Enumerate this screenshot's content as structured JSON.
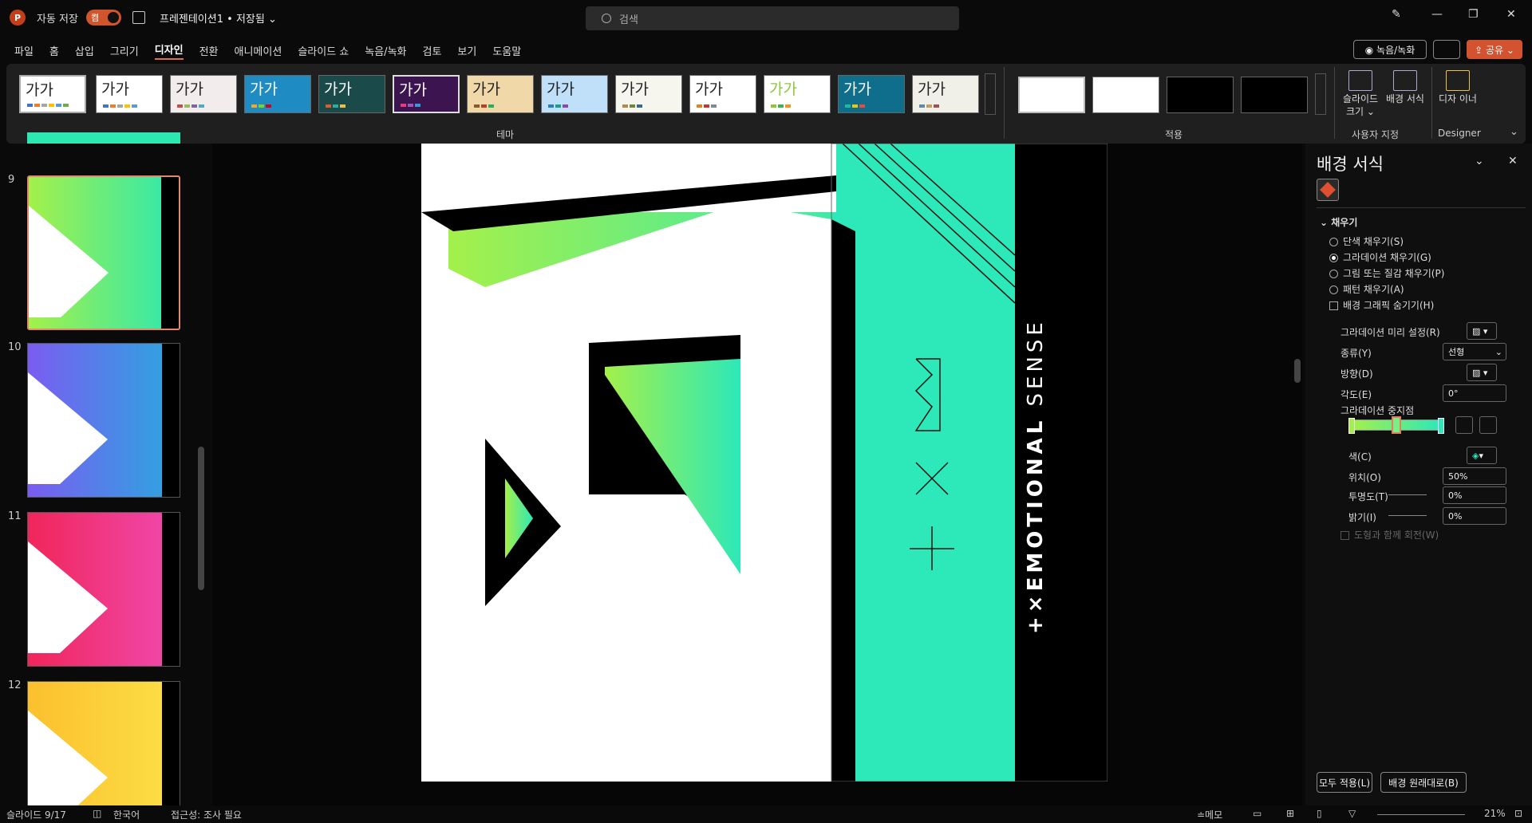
{
  "titlebar": {
    "app_icon": "P",
    "autosave_label": "자동 저장",
    "toggle_state": "켬",
    "doc_title": "프레젠테이션1 • 저장됨 ⌄",
    "search_placeholder": "검색"
  },
  "menu": {
    "items": [
      "파일",
      "홈",
      "삽입",
      "그리기",
      "디자인",
      "전환",
      "애니메이션",
      "슬라이드 쇼",
      "녹음/녹화",
      "검토",
      "보기",
      "도움말"
    ],
    "active": "디자인",
    "record_label": "◉ 녹음/녹화",
    "share_label": "⇪ 공유 ⌄"
  },
  "ribbon": {
    "theme_sample": "가가",
    "theme_group_label": "테마",
    "variant_group_label": "적용",
    "slide_size_label": "슬라이드 크기 ⌄",
    "bg_format_label": "배경 서식",
    "customize_group_label": "사용자 지정",
    "designer_label": "디자 이너",
    "designer_group_label": "Designer"
  },
  "slides_panel": {
    "numbers": [
      "9",
      "10",
      "11",
      "12"
    ],
    "thumb_text": "+×EMOTIONAL SENSE",
    "thumb_colors": [
      "#2de8b0",
      "#5a5ef0",
      "#f0338a",
      "#fbd520"
    ]
  },
  "slide": {
    "brand_bold": "+×EMOTIONAL",
    "brand_light": "SENSE"
  },
  "format_panel": {
    "title": "배경 서식",
    "section": "채우기",
    "options": [
      "단색 채우기(S)",
      "그라데이션 채우기(G)",
      "그림 또는 질감 채우기(P)",
      "패턴 채우기(A)"
    ],
    "selected_option": "그라데이션 채우기(G)",
    "hide_bg_label": "배경 그래픽 숨기기(H)",
    "preset_label": "그라데이션 미리 설정(R)",
    "type_label": "종류(Y)",
    "type_value": "선형",
    "direction_label": "방향(D)",
    "angle_label": "각도(E)",
    "angle_value": "0°",
    "stops_label": "그라데이션 중지점",
    "color_label": "색(C)",
    "position_label": "위치(O)",
    "position_value": "50%",
    "transparency_label": "투명도(T)",
    "transparency_value": "0%",
    "brightness_label": "밝기(I)",
    "brightness_value": "0%",
    "rotate_label": "도형과 함께 회전(W)",
    "apply_all_label": "모두 적용(L)",
    "reset_label": "배경 원래대로(B)"
  },
  "statusbar": {
    "slide_info": "슬라이드 9/17",
    "language": "한국어",
    "accessibility": "접근성: 조사 필요",
    "notes": "≐메모",
    "zoom": "21%"
  },
  "colors": {
    "accent": "#d35230",
    "grad_start": "#a4f04a",
    "grad_end": "#2de8b8"
  }
}
